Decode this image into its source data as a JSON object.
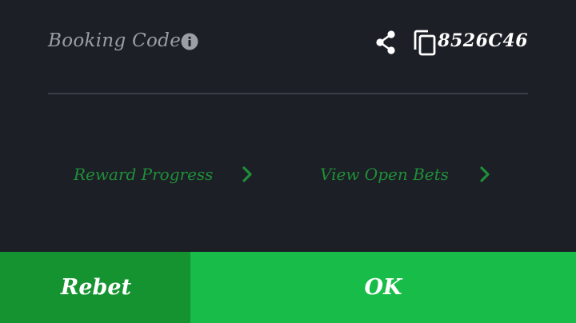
{
  "booking": {
    "label": "Booking Code",
    "code": "8526C46",
    "icons": [
      "info-icon",
      "share-icon",
      "copy-icon"
    ]
  },
  "links": {
    "reward_progress": "Reward Progress",
    "view_open_bets": "View Open Bets",
    "icon": "chevron-right-icon"
  },
  "actions": {
    "rebet_label": "Rebet",
    "ok_label": "OK"
  },
  "colors": {
    "background": "#1d1f26",
    "link_green": "#1e8f38",
    "rebet_green": "#149330",
    "ok_green": "#18bc48"
  }
}
